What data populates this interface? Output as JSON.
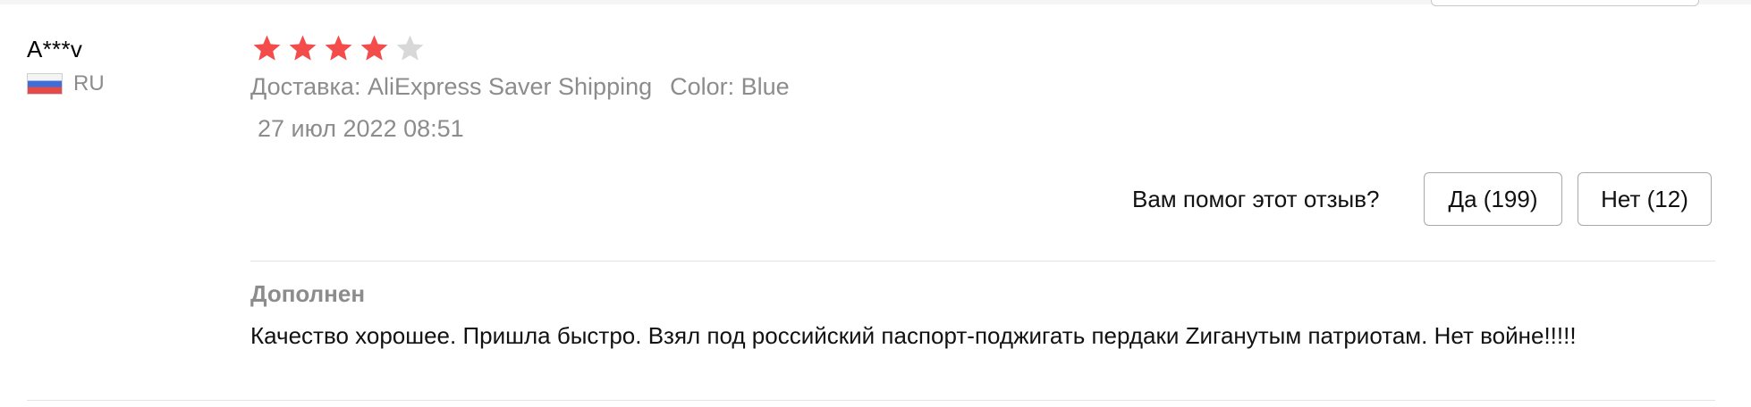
{
  "review": {
    "user": "A***v",
    "country": {
      "code": "RU",
      "flag": "russia-flag-icon"
    },
    "rating": {
      "value": 4,
      "max": 5,
      "filled_color": "#f44b4b",
      "empty_color": "#d8d8d8"
    },
    "shipping": "Доставка: AliExpress Saver Shipping",
    "color": "Color: Blue",
    "date": "27 июл 2022 08:51",
    "helpful": {
      "question": "Вам помог этот отзыв?",
      "yes_label": "Да (199)",
      "no_label": "Нет (12)"
    },
    "addendum": {
      "title": "Дополнен",
      "text": "Качество хорошее. Пришла быстро. Взял под российский паспорт-поджигать пердаки Zиганутым патриотам. Нет войне!!!!!"
    }
  }
}
